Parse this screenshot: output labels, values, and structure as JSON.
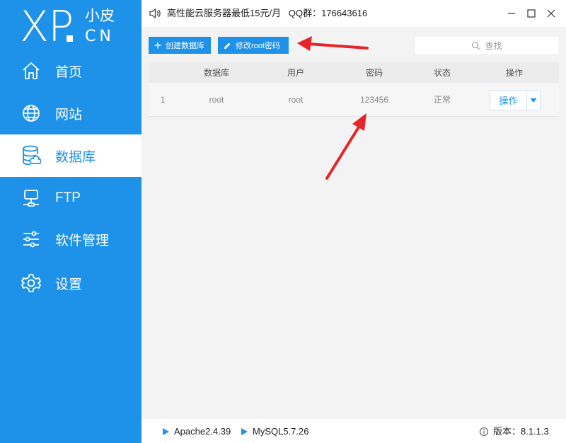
{
  "brand": {
    "logo_main": "XP",
    "logo_cn_top": "小皮",
    "logo_cn_bottom": "CN"
  },
  "sidebar": {
    "items": [
      {
        "label": "首页",
        "icon": "home-icon",
        "active": false
      },
      {
        "label": "网站",
        "icon": "globe-icon",
        "active": false
      },
      {
        "label": "数据库",
        "icon": "database-icon",
        "active": true
      },
      {
        "label": "FTP",
        "icon": "server-icon",
        "active": false
      },
      {
        "label": "软件管理",
        "icon": "sliders-icon",
        "active": false
      },
      {
        "label": "设置",
        "icon": "gear-icon",
        "active": false
      }
    ]
  },
  "header": {
    "notice": "高性能云服务器最低15元/月   QQ群：176643616"
  },
  "toolbar": {
    "create_label": "创建数据库",
    "modify_label": "修改root密码",
    "search_placeholder": "查找"
  },
  "table": {
    "headers": [
      "数据库",
      "用户",
      "密码",
      "状态",
      "操作"
    ],
    "rows": [
      {
        "index": "1",
        "database": "root",
        "user": "root",
        "password": "123456",
        "status": "正常",
        "action": "操作"
      }
    ]
  },
  "statusbar": {
    "apache": "Apache2.4.39",
    "mysql": "MySQL5.7.26",
    "version": "版本：8.1.1.3"
  },
  "colors": {
    "accent": "#1e91e8",
    "annotation": "#e5252a"
  }
}
